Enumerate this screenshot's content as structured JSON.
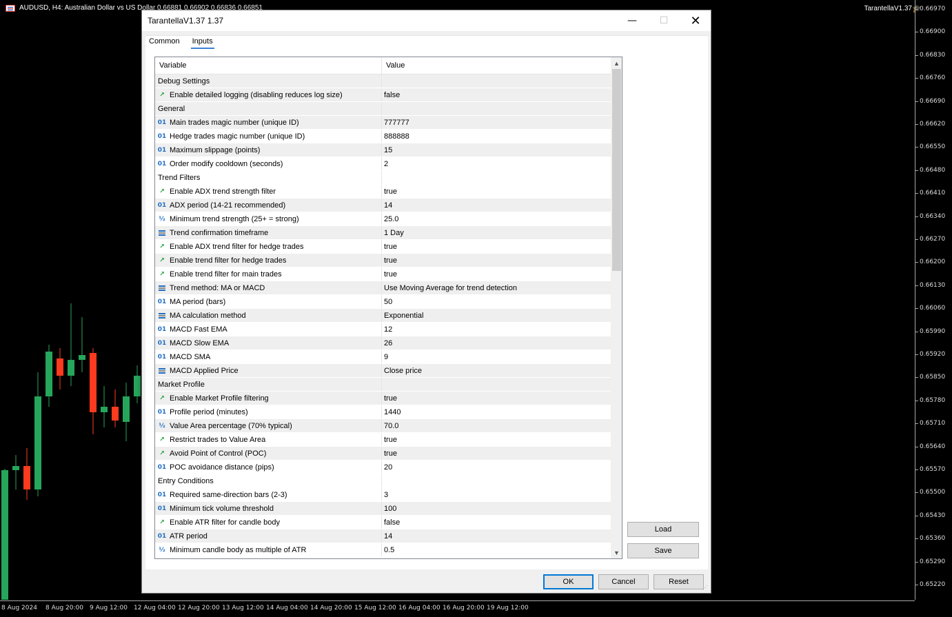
{
  "chart": {
    "title": "AUDUSD, H4:  Australian Dollar vs US Dollar  0.66881 0.66902 0.66836 0.66851",
    "ea_label": "TarantellaV1.37",
    "price_labels": [
      "0.66970",
      "0.66900",
      "0.66830",
      "0.66760",
      "0.66690",
      "0.66620",
      "0.66550",
      "0.66480",
      "0.66410",
      "0.66340",
      "0.66270",
      "0.66200",
      "0.66130",
      "0.66060",
      "0.65990",
      "0.65920",
      "0.65850",
      "0.65780",
      "0.65710",
      "0.65640",
      "0.65570",
      "0.65500",
      "0.65430",
      "0.65360",
      "0.65290",
      "0.65220"
    ],
    "time_labels": [
      "8 Aug 2024",
      "8 Aug 20:00",
      "9 Aug 12:00",
      "12 Aug 04:00",
      "12 Aug 20:00",
      "13 Aug 12:00",
      "14 Aug 04:00",
      "14 Aug 20:00",
      "15 Aug 12:00",
      "16 Aug 04:00",
      "16 Aug 20:00",
      "19 Aug 12:00"
    ],
    "colors": {
      "bull": "#26a65b",
      "bear": "#ff3b1f",
      "background": "#000000"
    }
  },
  "dialog": {
    "title": "TarantellaV1.37 1.37",
    "minimize_glyph": "—",
    "maximize_glyph": "☐",
    "close_glyph": "✕",
    "tabs": [
      {
        "label": "Common",
        "active": false
      },
      {
        "label": "Inputs",
        "active": true
      }
    ],
    "grid": {
      "col_variable": "Variable",
      "col_value": "Value",
      "rows": [
        {
          "kind": "group",
          "name": "Debug Settings",
          "value": ""
        },
        {
          "kind": "bool",
          "name": "Enable detailed logging (disabling reduces log size)",
          "value": "false"
        },
        {
          "kind": "group",
          "name": "General",
          "value": ""
        },
        {
          "kind": "int",
          "name": "Main trades magic number (unique ID)",
          "value": "777777"
        },
        {
          "kind": "int",
          "name": "Hedge trades magic number (unique ID)",
          "value": "888888"
        },
        {
          "kind": "int",
          "name": "Maximum slippage (points)",
          "value": "15"
        },
        {
          "kind": "int",
          "name": "Order modify cooldown (seconds)",
          "value": "2"
        },
        {
          "kind": "group",
          "name": "Trend Filters",
          "value": ""
        },
        {
          "kind": "bool",
          "name": "Enable ADX trend strength filter",
          "value": "true"
        },
        {
          "kind": "int",
          "name": "ADX period (14-21 recommended)",
          "value": "14"
        },
        {
          "kind": "double",
          "name": "Minimum trend strength (25+ = strong)",
          "value": "25.0"
        },
        {
          "kind": "enum",
          "name": "Trend confirmation timeframe",
          "value": "1 Day"
        },
        {
          "kind": "bool",
          "name": "Enable ADX trend filter for hedge trades",
          "value": "true"
        },
        {
          "kind": "bool",
          "name": "Enable trend filter for hedge trades",
          "value": "true"
        },
        {
          "kind": "bool",
          "name": "Enable trend filter for main trades",
          "value": "true"
        },
        {
          "kind": "enum",
          "name": "Trend method: MA or MACD",
          "value": "Use Moving Average for trend detection"
        },
        {
          "kind": "int",
          "name": "MA period (bars)",
          "value": "50"
        },
        {
          "kind": "enum",
          "name": "MA calculation method",
          "value": "Exponential"
        },
        {
          "kind": "int",
          "name": "MACD Fast EMA",
          "value": "12"
        },
        {
          "kind": "int",
          "name": "MACD Slow EMA",
          "value": "26"
        },
        {
          "kind": "int",
          "name": "MACD SMA",
          "value": "9"
        },
        {
          "kind": "enum",
          "name": "MACD Applied Price",
          "value": "Close price"
        },
        {
          "kind": "group",
          "name": "Market Profile",
          "value": ""
        },
        {
          "kind": "bool",
          "name": "Enable Market Profile filtering",
          "value": "true"
        },
        {
          "kind": "int",
          "name": "Profile period (minutes)",
          "value": "1440"
        },
        {
          "kind": "double",
          "name": "Value Area percentage (70% typical)",
          "value": "70.0"
        },
        {
          "kind": "bool",
          "name": "Restrict trades to Value Area",
          "value": "true"
        },
        {
          "kind": "bool",
          "name": "Avoid Point of Control (POC)",
          "value": "true"
        },
        {
          "kind": "int",
          "name": "POC avoidance distance (pips)",
          "value": "20"
        },
        {
          "kind": "group",
          "name": "Entry Conditions",
          "value": ""
        },
        {
          "kind": "int",
          "name": "Required same-direction bars (2-3)",
          "value": "3"
        },
        {
          "kind": "int",
          "name": "Minimum tick volume threshold",
          "value": "100"
        },
        {
          "kind": "bool",
          "name": "Enable ATR filter for candle body",
          "value": "false"
        },
        {
          "kind": "int",
          "name": "ATR period",
          "value": "14"
        },
        {
          "kind": "double",
          "name": "Minimum candle body as multiple of ATR",
          "value": "0.5"
        }
      ]
    },
    "icons": {
      "int": "01",
      "bool": "↗",
      "double": "½",
      "enum": "enum-icon"
    },
    "buttons": {
      "load": "Load",
      "save": "Save",
      "ok": "OK",
      "cancel": "Cancel",
      "reset": "Reset"
    }
  }
}
